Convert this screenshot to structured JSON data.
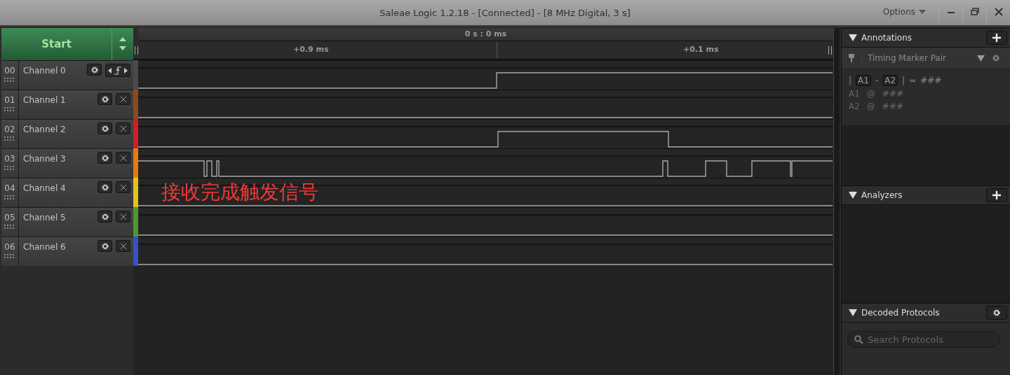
{
  "window": {
    "title": "Saleae Logic 1.2.18 - [Connected] - [8 MHz Digital, 3 s]",
    "menu": "Options"
  },
  "start_button": "Start",
  "timeline": {
    "center_label": "0 s : 0 ms",
    "ticks": [
      "+0.9 ms",
      "+0.1 ms"
    ]
  },
  "channels": [
    {
      "number": "00",
      "name": "Channel 0",
      "kind": "trigger",
      "color": "#4a4a4a"
    },
    {
      "number": "01",
      "name": "Channel 1",
      "kind": "normal",
      "color": "#8a4a1c"
    },
    {
      "number": "02",
      "name": "Channel 2",
      "kind": "normal",
      "color": "#d01e28"
    },
    {
      "number": "03",
      "name": "Channel 3",
      "kind": "normal",
      "color": "#e07c10"
    },
    {
      "number": "04",
      "name": "Channel 4",
      "kind": "normal",
      "color": "#e2c21e"
    },
    {
      "number": "05",
      "name": "Channel 5",
      "kind": "normal",
      "color": "#4c9a2c"
    },
    {
      "number": "06",
      "name": "Channel 6",
      "kind": "normal",
      "color": "#3a50c8"
    }
  ],
  "overlay_note": "接收完成触发信号",
  "annotations": {
    "title": "Annotations",
    "marker": "Timing Marker Pair",
    "formula": [
      {
        "text": "|",
        "kind": "plain"
      },
      {
        "text": "A1",
        "kind": "chip"
      },
      {
        "text": "-",
        "kind": "plain"
      },
      {
        "text": "A2",
        "kind": "chip"
      },
      {
        "text": "|",
        "kind": "plain"
      },
      {
        "text": "=",
        "kind": "plain"
      },
      {
        "text": "###",
        "kind": "value"
      }
    ],
    "rows": [
      {
        "marker": "A1",
        "at": "@",
        "value": "###"
      },
      {
        "marker": "A2",
        "at": "@",
        "value": "###"
      }
    ]
  },
  "analyzers": {
    "title": "Analyzers"
  },
  "decoded_protocols": {
    "title": "Decoded Protocols",
    "placeholder": "Search Protocols"
  }
}
